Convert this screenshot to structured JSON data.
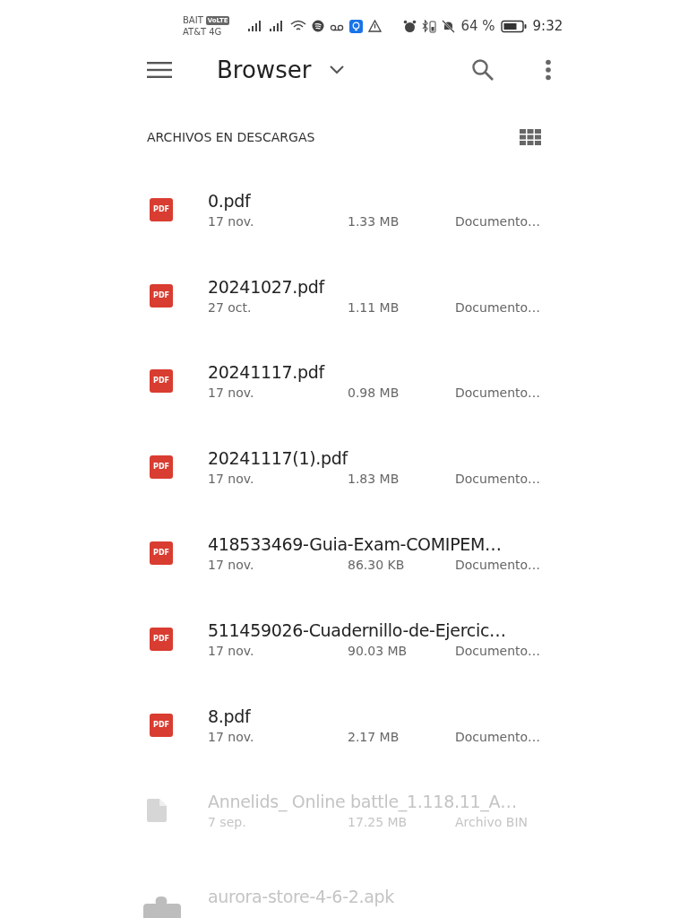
{
  "status_bar": {
    "carrier_1": "BAIT",
    "volte_badge": "VoLTE",
    "carrier_2": "AT&T 4G",
    "battery": "64 %",
    "time": "9:32"
  },
  "app_bar": {
    "title": "Browser"
  },
  "section": {
    "title": "ARCHIVOS EN DESCARGAS"
  },
  "files": [
    {
      "kind": "pdf",
      "badge": "PDF",
      "name": "0.pdf",
      "date": "17 nov.",
      "size": "1.33 MB",
      "type": "Documento…",
      "disabled": false
    },
    {
      "kind": "pdf",
      "badge": "PDF",
      "name": "20241027.pdf",
      "date": "27 oct.",
      "size": "1.11 MB",
      "type": "Documento…",
      "disabled": false
    },
    {
      "kind": "pdf",
      "badge": "PDF",
      "name": "20241117.pdf",
      "date": "17 nov.",
      "size": "0.98 MB",
      "type": "Documento…",
      "disabled": false
    },
    {
      "kind": "pdf",
      "badge": "PDF",
      "name": "20241117(1).pdf",
      "date": "17 nov.",
      "size": "1.83 MB",
      "type": "Documento…",
      "disabled": false
    },
    {
      "kind": "pdf",
      "badge": "PDF",
      "name": "418533469-Guia-Exam-COMIPEM…",
      "date": "17 nov.",
      "size": "86.30 KB",
      "type": "Documento…",
      "disabled": false
    },
    {
      "kind": "pdf",
      "badge": "PDF",
      "name": "511459026-Cuadernillo-de-Ejercic…",
      "date": "17 nov.",
      "size": "90.03 MB",
      "type": "Documento…",
      "disabled": false
    },
    {
      "kind": "pdf",
      "badge": "PDF",
      "name": "8.pdf",
      "date": "17 nov.",
      "size": "2.17 MB",
      "type": "Documento…",
      "disabled": false
    },
    {
      "kind": "file",
      "name": "Annelids_ Online battle_1.118.11_A…",
      "date": "7 sep.",
      "size": "17.25 MB",
      "type": "Archivo BIN",
      "disabled": true
    },
    {
      "kind": "apk",
      "name": "aurora-store-4-6-2.apk",
      "disabled": true
    }
  ]
}
